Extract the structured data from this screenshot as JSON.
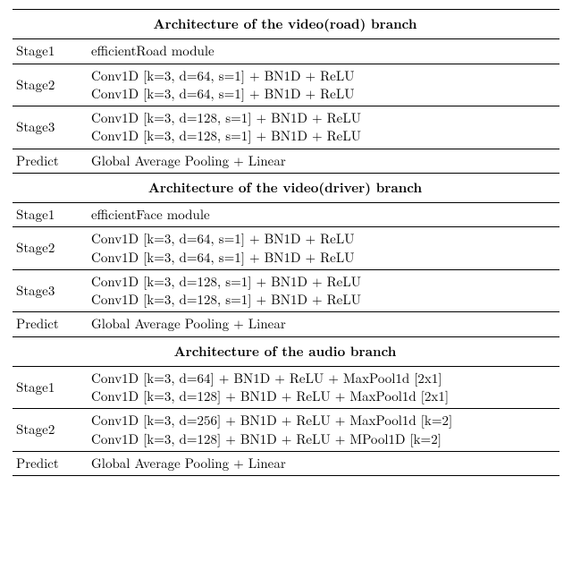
{
  "sec_road": {
    "header": "Architecture of the video(road) branch",
    "s1": {
      "label": "Stage1",
      "line1": "efficientRoad module"
    },
    "s2": {
      "label": "Stage2",
      "line1": "Conv1D [k=3, d=64, s=1] + BN1D + ReLU",
      "line2": "Conv1D [k=3, d=64, s=1] + BN1D + ReLU"
    },
    "s3": {
      "label": "Stage3",
      "line1": "Conv1D [k=3, d=128, s=1] + BN1D + ReLU",
      "line2": "Conv1D [k=3, d=128, s=1] + BN1D + ReLU"
    },
    "p": {
      "label": "Predict",
      "line1": "Global Average Pooling + Linear"
    }
  },
  "sec_driver": {
    "header": "Architecture of the video(driver) branch",
    "s1": {
      "label": "Stage1",
      "line1": "efficientFace module"
    },
    "s2": {
      "label": "Stage2",
      "line1": "Conv1D [k=3, d=64, s=1] + BN1D + ReLU",
      "line2": "Conv1D [k=3, d=64, s=1] + BN1D + ReLU"
    },
    "s3": {
      "label": "Stage3",
      "line1": "Conv1D [k=3, d=128, s=1] + BN1D + ReLU",
      "line2": "Conv1D [k=3, d=128, s=1] + BN1D + ReLU"
    },
    "p": {
      "label": "Predict",
      "line1": "Global Average Pooling + Linear"
    }
  },
  "sec_audio": {
    "header": "Architecture of the audio branch",
    "s1": {
      "label": "Stage1",
      "line1": "Conv1D [k=3, d=64] + BN1D + ReLU + MaxPool1d [2x1]",
      "line2": "Conv1D [k=3, d=128] + BN1D + ReLU + MaxPool1d [2x1]"
    },
    "s2": {
      "label": "Stage2",
      "line1": "Conv1D [k=3, d=256] + BN1D + ReLU + MaxPool1d [k=2]",
      "line2": "Conv1D [k=3, d=128] + BN1D + ReLU + MPool1D [k=2]"
    },
    "p": {
      "label": "Predict",
      "line1": "Global Average Pooling + Linear"
    }
  }
}
